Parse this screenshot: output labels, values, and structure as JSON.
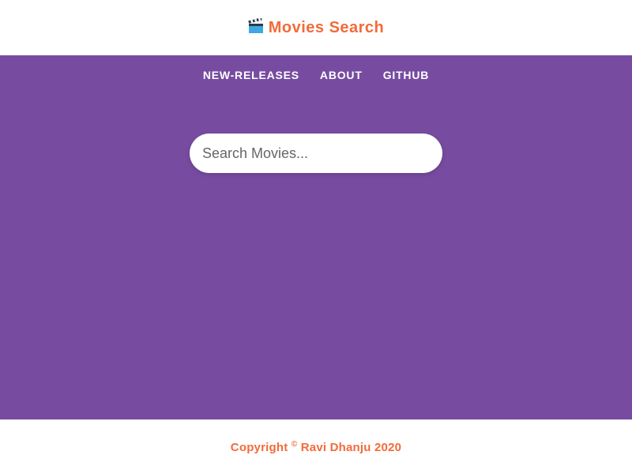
{
  "header": {
    "brand_icon": "clapper-board-icon",
    "brand_title": "Movies Search",
    "brand_color": "#f26b3a"
  },
  "nav": {
    "items": [
      {
        "label": "new-releases"
      },
      {
        "label": "about"
      },
      {
        "label": "github"
      }
    ]
  },
  "search": {
    "placeholder": "Search Movies...",
    "value": ""
  },
  "footer": {
    "prefix": "Copyright",
    "symbol": "©",
    "author_year": "Ravi Dhanju 2020"
  },
  "colors": {
    "main_background": "#774ca0",
    "accent": "#f26b3a",
    "nav_text": "#ffffff"
  }
}
